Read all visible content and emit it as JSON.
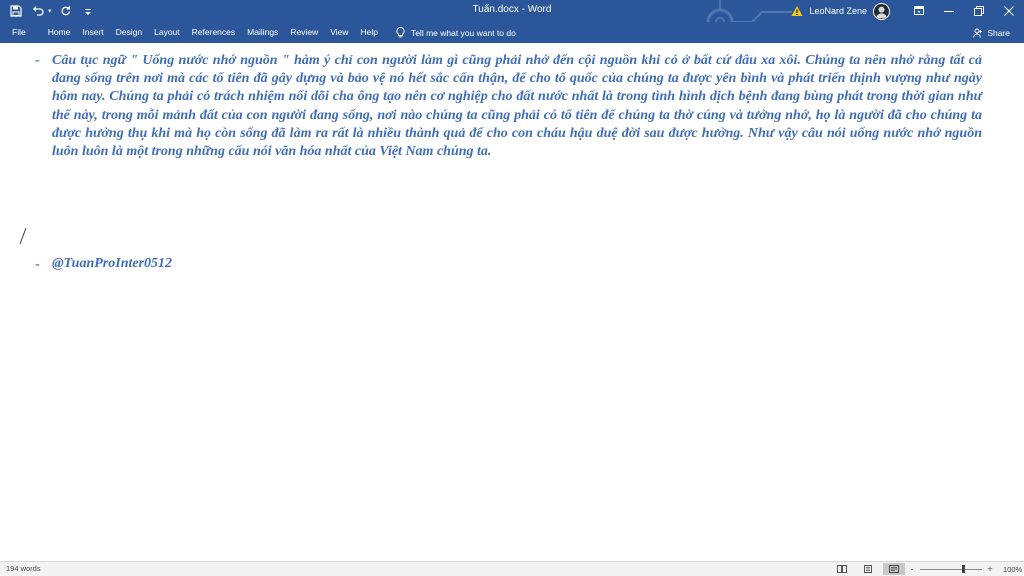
{
  "window": {
    "title": "Tuấn.docx  -  Word",
    "user_name": "LeoNard Zene"
  },
  "quick_access": {
    "save_icon": "save-icon",
    "undo_icon": "undo-icon",
    "redo_icon": "redo-icon",
    "customize_icon": "customize-icon"
  },
  "ribbon": {
    "tabs": [
      "File",
      "Home",
      "Insert",
      "Design",
      "Layout",
      "References",
      "Mailings",
      "Review",
      "View",
      "Help"
    ],
    "tell_me": "Tell me what you want to do",
    "share": "Share"
  },
  "document": {
    "bullet": "-",
    "paragraph": "Câu tục ngữ \" Uống nước nhớ nguồn \" hàm ý chỉ con người làm gì cũng phải nhớ đến cội nguồn khi có ở bất cứ đâu xa xôi. Chúng ta nên nhớ rằng tất cả đang sống trên nơi mà các tổ tiên đã gây dựng và bảo vệ nó hết sắc cẩn thận, để cho tổ quốc của chúng ta được yên bình và phát triển thịnh vượng như ngày hôm nay. Chúng ta phải có trách nhiệm nối dõi cha ông tạo nên cơ nghiệp cho đất nước nhất là trong tình hình dịch bệnh đang bùng phát trong thời gian như thế này, trong mỗi mảnh đất của con người đang sống, nơi nào chúng ta cũng phải có tổ tiên để chúng ta thờ cúng và tưởng nhớ, họ là người đã cho chúng ta được hưởng thụ khi mà họ còn sống đã làm ra rất là nhiều thành quả để cho con cháu hậu duệ đời sau được hưởng. Như vậy câu nói uống nước nhớ nguồn luôn luôn là một trong những cấu nói văn hóa nhất của Việt Nam chúng ta.",
    "handle": "@TuanProInter0512"
  },
  "status": {
    "word_count": "194 words",
    "zoom_level": "100%",
    "zoom_minus": "-",
    "zoom_plus": "+"
  },
  "colors": {
    "title_bar": "#2b579a",
    "document_text": "#3f6db7",
    "status_bar": "#f3f3f3"
  }
}
